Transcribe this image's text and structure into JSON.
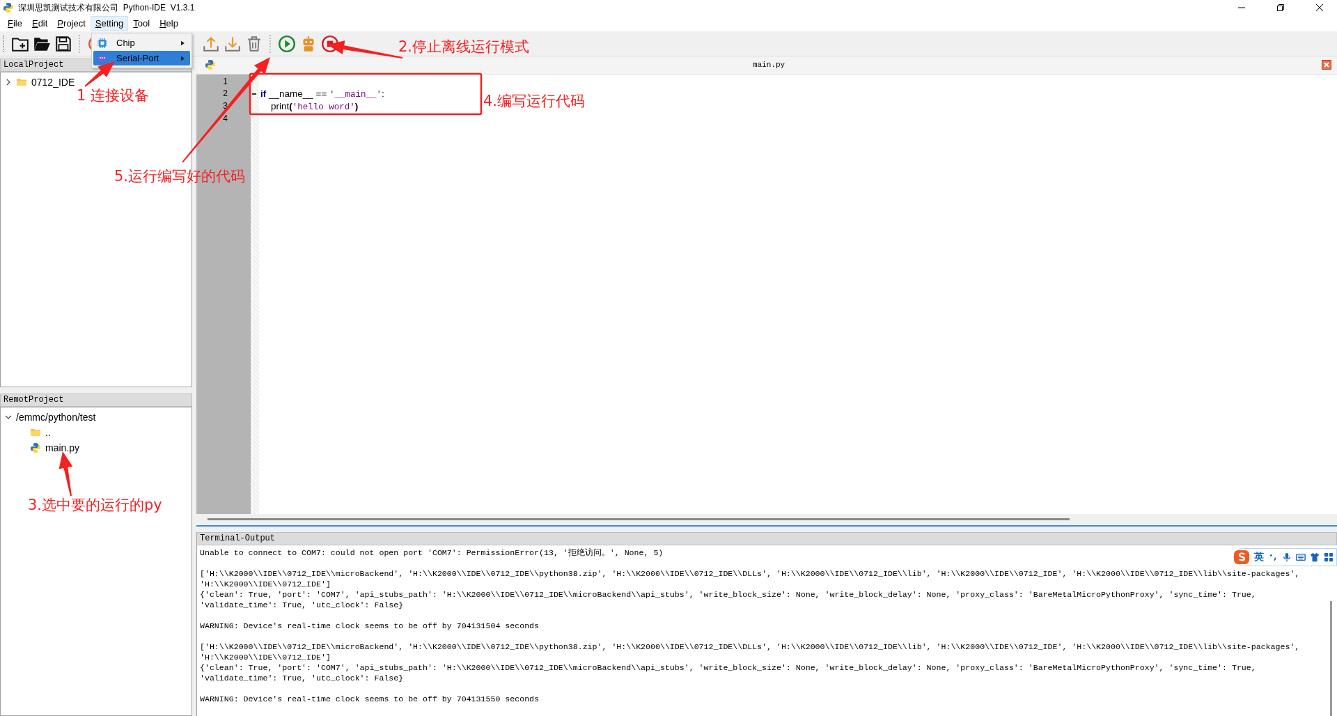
{
  "window": {
    "title": "深圳思凯测试技术有限公司  Python-IDE  V1.3.1"
  },
  "menu_bar": [
    {
      "label": "File",
      "selected": false
    },
    {
      "label": "Edit",
      "selected": false
    },
    {
      "label": "Project",
      "selected": false
    },
    {
      "label": "Setting",
      "selected": true
    },
    {
      "label": "Tool",
      "selected": false
    },
    {
      "label": "Help",
      "selected": false
    }
  ],
  "setting_menu": [
    {
      "label": "Chip",
      "kind": "chip",
      "selected": false
    },
    {
      "label": "Serial-Port",
      "kind": "serial",
      "selected": true
    }
  ],
  "local_project": {
    "title": "LocalProject",
    "tree": [
      {
        "label": "0712_IDE",
        "kind": "folder",
        "expanded": false
      }
    ]
  },
  "remote_project": {
    "title": "RemotProject",
    "tree": [
      {
        "label": "/emmc/python/test",
        "expanded": true,
        "children": [
          {
            "label": "..",
            "kind": "folder"
          },
          {
            "label": "main.py",
            "kind": "python"
          }
        ]
      }
    ]
  },
  "editor": {
    "tab": "main.py",
    "lines": [
      {
        "number": "1",
        "fold": false
      },
      {
        "number": "2",
        "fold": true,
        "tokens": [
          {
            "text": "if",
            "kind": "keyword"
          },
          {
            "text": " __name__ == ",
            "kind": "plain"
          },
          {
            "text": "'__main__'",
            "kind": "string"
          },
          {
            "text": ":",
            "kind": "plain"
          }
        ]
      },
      {
        "number": "3",
        "fold": false,
        "tokens": [
          {
            "text": "    print",
            "kind": "plain"
          },
          {
            "text": "(",
            "kind": "paren"
          },
          {
            "text": "'hello word'",
            "kind": "string"
          },
          {
            "text": ")",
            "kind": "paren"
          }
        ]
      },
      {
        "number": "4",
        "fold": false
      }
    ]
  },
  "terminal": {
    "title": "Terminal-Output",
    "blocks": [
      [
        "Unable to connect to COM7: could not open port 'COM7': PermissionError(13, '拒绝访问。', None, 5)"
      ],
      [
        "['H:\\\\K2000\\\\IDE\\\\0712_IDE\\\\microBackend', 'H:\\\\K2000\\\\IDE\\\\0712_IDE\\\\python38.zip', 'H:\\\\K2000\\\\IDE\\\\0712_IDE\\\\DLLs', 'H:\\\\K2000\\\\IDE\\\\0712_IDE\\\\lib', 'H:\\\\K2000\\\\IDE\\\\0712_IDE', 'H:\\\\K2000\\\\IDE\\\\0712_IDE\\\\lib\\\\site-packages',",
        "'H:\\\\K2000\\\\IDE\\\\0712_IDE']",
        "{'clean': True, 'port': 'COM7', 'api_stubs_path': 'H:\\\\K2000\\\\IDE\\\\0712_IDE\\\\microBackend\\\\api_stubs', 'write_block_size': None, 'write_block_delay': None, 'proxy_class': 'BareMetalMicroPythonProxy', 'sync_time': True,",
        "'validate_time': True, 'utc_clock': False}"
      ],
      [
        "WARNING: Device's real-time clock seems to be off by 704131504 seconds"
      ],
      [
        "['H:\\\\K2000\\\\IDE\\\\0712_IDE\\\\microBackend', 'H:\\\\K2000\\\\IDE\\\\0712_IDE\\\\python38.zip', 'H:\\\\K2000\\\\IDE\\\\0712_IDE\\\\DLLs', 'H:\\\\K2000\\\\IDE\\\\0712_IDE\\\\lib', 'H:\\\\K2000\\\\IDE\\\\0712_IDE', 'H:\\\\K2000\\\\IDE\\\\0712_IDE\\\\lib\\\\site-packages',",
        "'H:\\\\K2000\\\\IDE\\\\0712_IDE']",
        "{'clean': True, 'port': 'COM7', 'api_stubs_path': 'H:\\\\K2000\\\\IDE\\\\0712_IDE\\\\microBackend\\\\api_stubs', 'write_block_size': None, 'write_block_delay': None, 'proxy_class': 'BareMetalMicroPythonProxy', 'sync_time': True,",
        "'validate_time': True, 'utc_clock': False}"
      ],
      [
        "WARNING: Device's real-time clock seems to be off by 704131550 seconds"
      ]
    ]
  },
  "ime_bar": {
    "label": "英"
  },
  "annotations": [
    "1 连接设备",
    "2.停止离线运行模式",
    "3.选中要的运行的py",
    "4.编写运行代码",
    "5.运行编写好的代码"
  ]
}
